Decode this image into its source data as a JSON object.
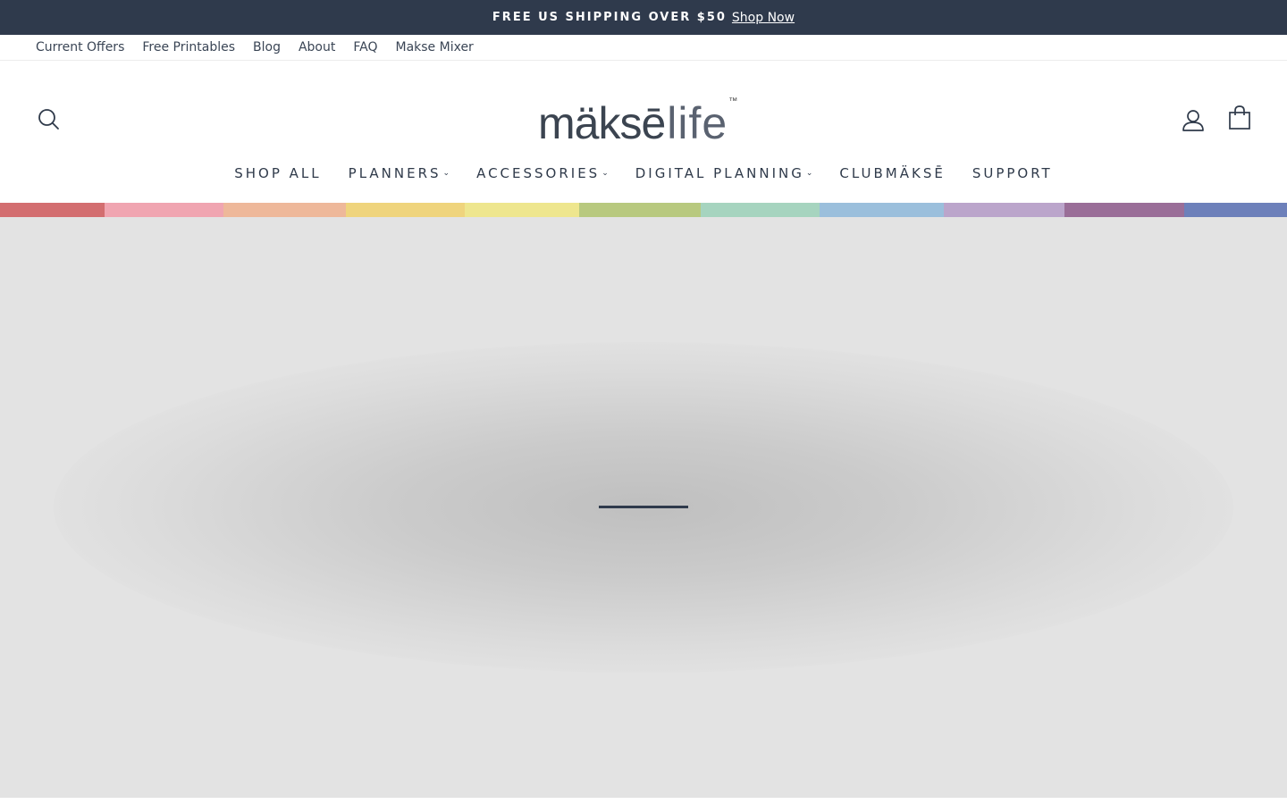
{
  "announcement": {
    "text": "FREE US SHIPPING OVER $50",
    "link": "Shop Now"
  },
  "top_links": [
    "Current Offers",
    "Free Printables",
    "Blog",
    "About",
    "FAQ",
    "Makse Mixer"
  ],
  "logo": {
    "main": "mäksē",
    "life": "life",
    "tm": "™"
  },
  "icons": {
    "search": "search-icon",
    "account": "user-icon",
    "cart": "shopping-bag-icon"
  },
  "main_nav": [
    {
      "label": "SHOP ALL",
      "dropdown": false
    },
    {
      "label": "PLANNERS",
      "dropdown": true
    },
    {
      "label": "ACCESSORIES",
      "dropdown": true
    },
    {
      "label": "DIGITAL PLANNING",
      "dropdown": true
    },
    {
      "label": "CLUBMÄKSĒ",
      "dropdown": false
    },
    {
      "label": "SUPPORT",
      "dropdown": false
    }
  ],
  "rainbow_colors": [
    "#d36e70",
    "#f0a5b1",
    "#eeb89a",
    "#efd47d",
    "#eee68e",
    "#b8c97f",
    "#a6d4bf",
    "#9bbfdc",
    "#bba5cb",
    "#9a6e98",
    "#6d80ba"
  ],
  "hero": {
    "background": "#e3e3e3",
    "loader_color": "#2f3a4c"
  }
}
